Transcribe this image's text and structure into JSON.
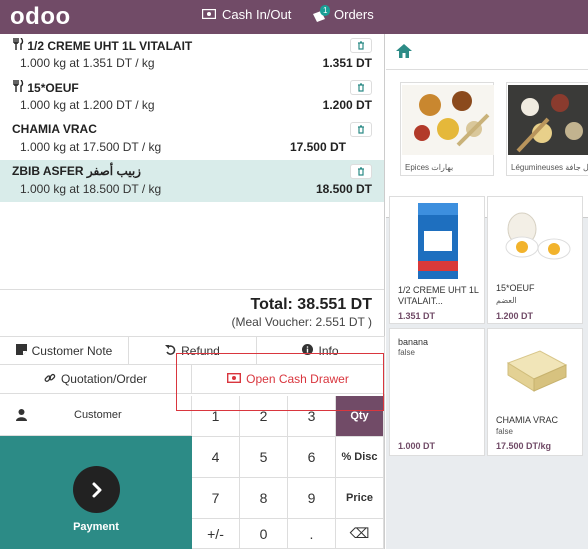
{
  "header": {
    "logo": "odoo",
    "cash_label": "Cash In/Out",
    "orders_label": "Orders",
    "orders_count": "1"
  },
  "orderlines": [
    {
      "name": "1/2 CREME UHT 1L VITALAIT",
      "detail": "1.000 kg at 1.351 DT / kg",
      "price": "1.351 DT"
    },
    {
      "name": "15*OEUF",
      "detail": "1.000 kg at 1.200 DT / kg",
      "price": "1.200 DT"
    },
    {
      "name": "CHAMIA VRAC",
      "detail": "1.000 kg at 17.500 DT / kg",
      "price": "17.500 DT"
    },
    {
      "name": "ZBIB ASFER زبيب أصفر",
      "detail": "1.000 kg at 18.500 DT / kg",
      "price": "18.500 DT"
    }
  ],
  "totals": {
    "total": "Total: 38.551 DT",
    "voucher": "(Meal Voucher: 2.551 DT )"
  },
  "controls": {
    "customer_note": "Customer Note",
    "refund": "Refund",
    "info": "Info",
    "quotation": "Quotation/Order",
    "open_cash_drawer": "Open Cash Drawer"
  },
  "numpad": {
    "customer": "Customer",
    "payment": "Payment",
    "keys": [
      "1",
      "2",
      "3",
      "Qty",
      "4",
      "5",
      "6",
      "% Disc",
      "7",
      "8",
      "9",
      "Price",
      "+/-",
      "0",
      ".",
      "⌫"
    ]
  },
  "categories": [
    {
      "label": "Epices بهارات"
    },
    {
      "label": "Légumineuses بقول جافة"
    }
  ],
  "products": [
    {
      "name": "1/2 CREME UHT 1L VITALAIT...",
      "price": "1.351 DT"
    },
    {
      "name": "15*OEUF",
      "sub": "العضم",
      "price": "1.200 DT"
    },
    {
      "name": "banana",
      "sub": "false",
      "price": "1.000 DT"
    },
    {
      "name": "CHAMIA VRAC",
      "sub": "false",
      "price": "17.500 DT/kg"
    }
  ],
  "colors": {
    "brand": "#714b67",
    "payment": "#2c8b86",
    "danger": "#d9363e",
    "selected_line": "#d9ecea"
  }
}
